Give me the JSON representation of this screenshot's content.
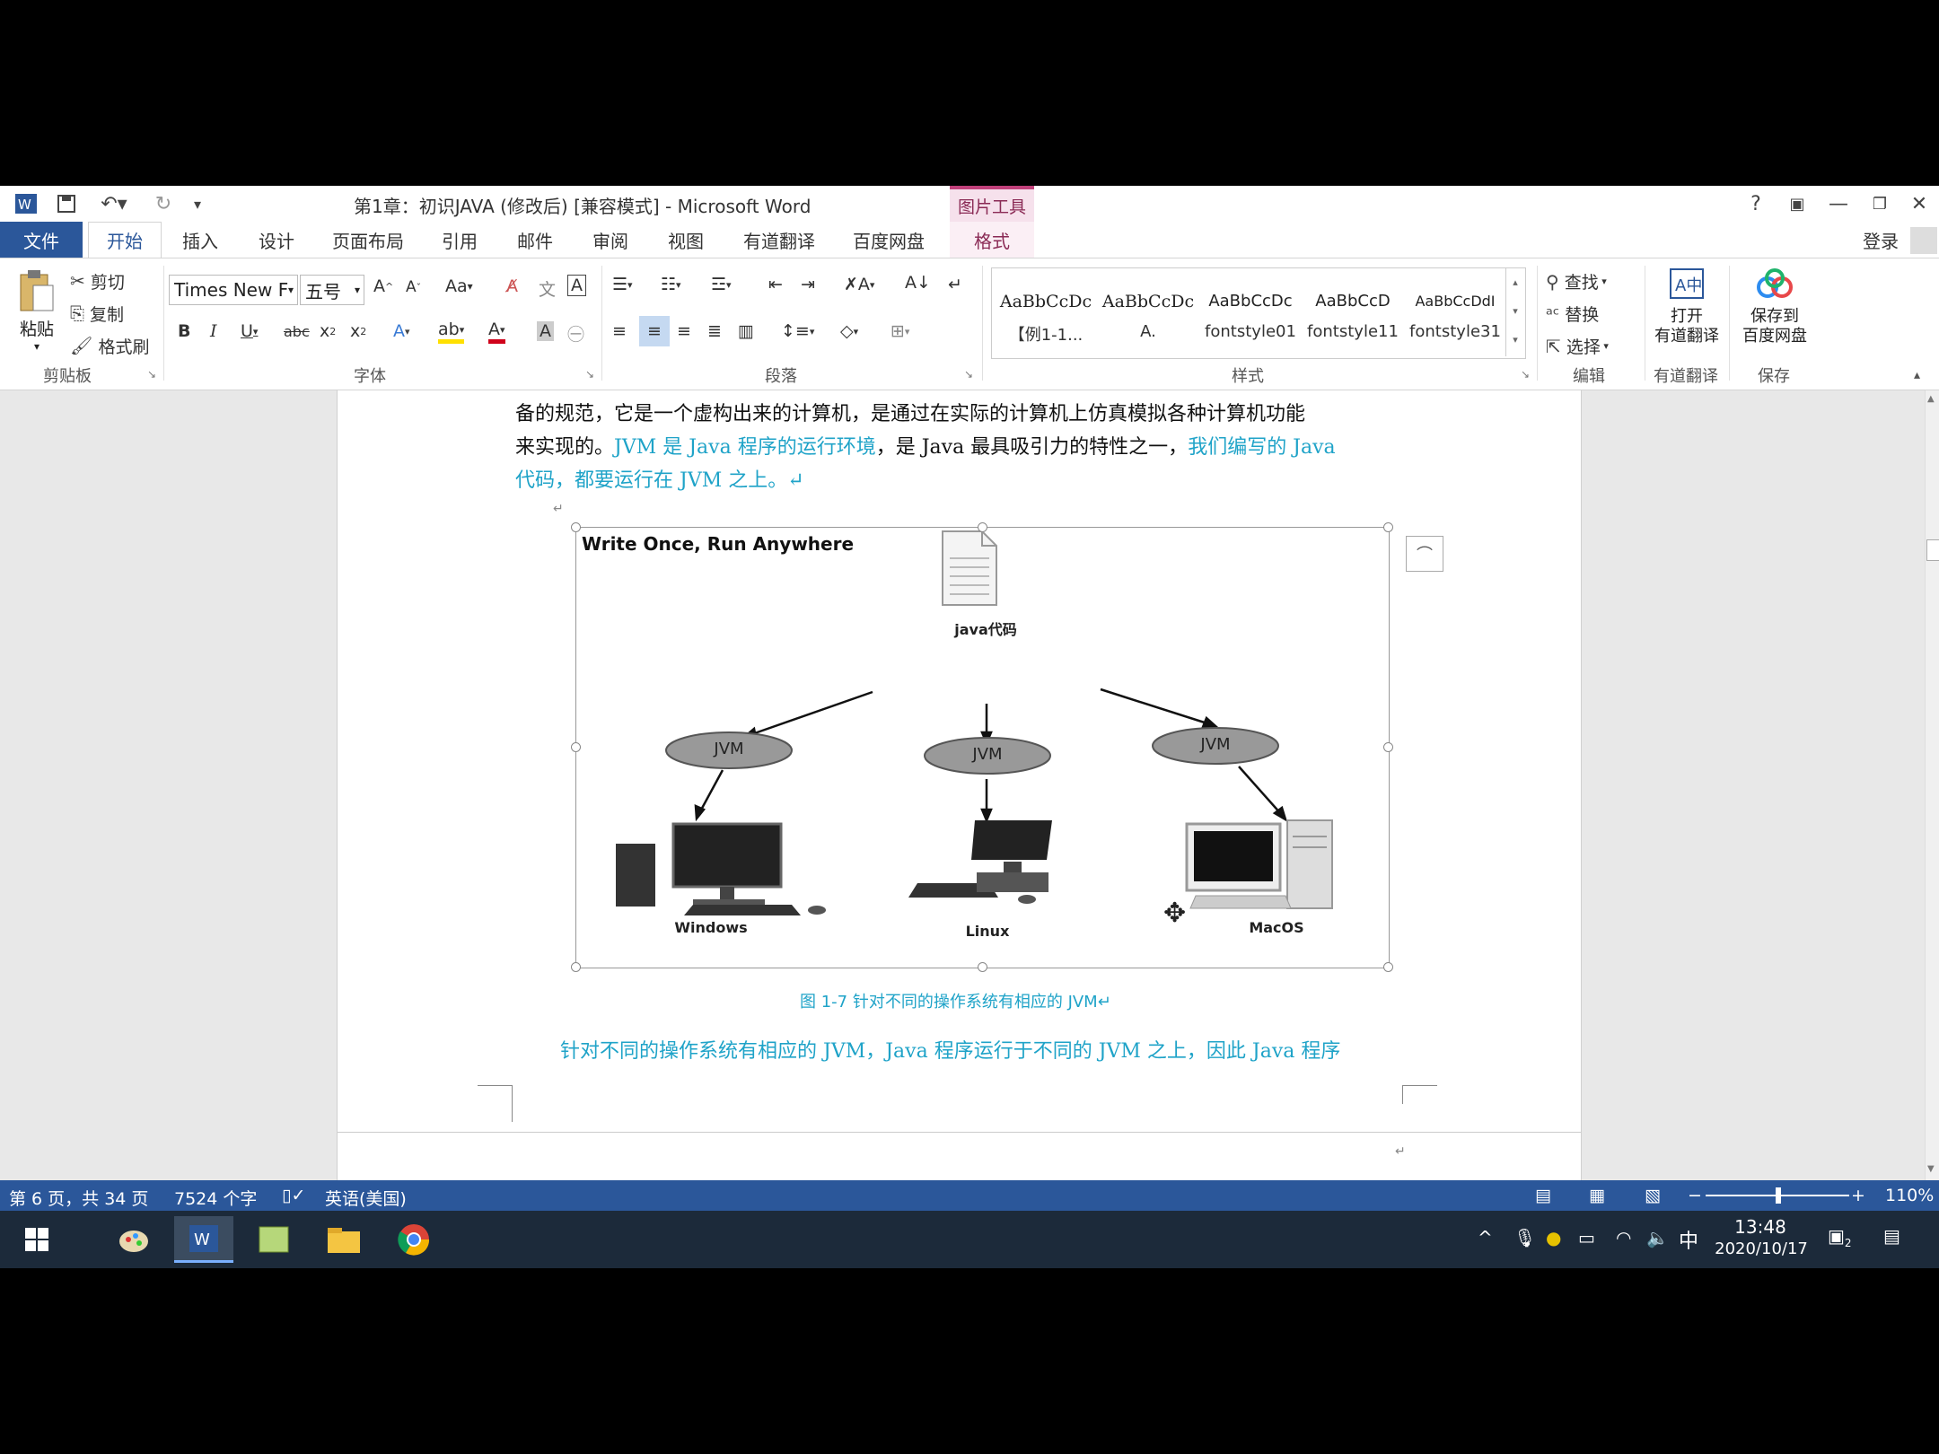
{
  "window": {
    "title": "第1章：初识JAVA (修改后) [兼容模式] - Microsoft Word",
    "contextual_group": "图片工具",
    "help": "?",
    "sign_in": "登录"
  },
  "tabs": [
    "文件",
    "开始",
    "插入",
    "设计",
    "页面布局",
    "引用",
    "邮件",
    "审阅",
    "视图",
    "有道翻译",
    "百度网盘",
    "格式"
  ],
  "ribbon": {
    "clipboard": {
      "paste": "粘贴",
      "cut": "剪切",
      "copy": "复制",
      "format_painter": "格式刷",
      "label": "剪贴板"
    },
    "font": {
      "name": "Times New F",
      "size": "五号",
      "change_case": "Aa",
      "label": "字体"
    },
    "paragraph": {
      "label": "段落"
    },
    "styles": {
      "items": [
        {
          "preview": "AaBbCcDc",
          "name": "【例1-1..."
        },
        {
          "preview": "AaBbCcDc",
          "name": "A."
        },
        {
          "preview": "AaBbCcDc",
          "name": "fontstyle01"
        },
        {
          "preview": "AaBbCcD",
          "name": "fontstyle11"
        },
        {
          "preview": "AaBbCcDdI",
          "name": "fontstyle31"
        }
      ],
      "label": "样式"
    },
    "editing": {
      "find": "查找",
      "replace": "替换",
      "select": "选择",
      "label": "编辑"
    },
    "youdao": {
      "button_line1": "打开",
      "button_line2": "有道翻译",
      "label": "有道翻译"
    },
    "baidu": {
      "button_line1": "保存到",
      "button_line2": "百度网盘",
      "label": "保存"
    }
  },
  "document": {
    "line1": "备的规范，它是一个虚构出来的计算机，是通过在实际的计算机上仿真模拟各种计算机功能",
    "line2_a": "来实现的。",
    "line2_b": "JVM 是 Java 程序的运行环境",
    "line2_c": "，是 Java 最具吸引力的特性之一，",
    "line2_d": "我们编写的 Java",
    "line3": "代码，都要运行在  JVM  之上。↵",
    "figure": {
      "headline": "Write Once, Run Anywhere",
      "source_label": "java代码",
      "jvm_label": "JVM",
      "os": [
        "Windows",
        "Linux",
        "MacOS"
      ]
    },
    "caption": "图 1-7    针对不同的操作系统有相应的 JVM↵",
    "line4": "针对不同的操作系统有相应的 JVM，Java 程序运行于不同的 JVM 之上，因此 Java 程序"
  },
  "status": {
    "page": "第 6 页，共 34 页",
    "words": "7524 个字",
    "language": "英语(美国)",
    "zoom": "110%",
    "zoom_minus": "−",
    "zoom_plus": "+"
  },
  "taskbar": {
    "time": "13:48",
    "date": "2020/10/17",
    "ime": "中",
    "notif_count": "2"
  }
}
